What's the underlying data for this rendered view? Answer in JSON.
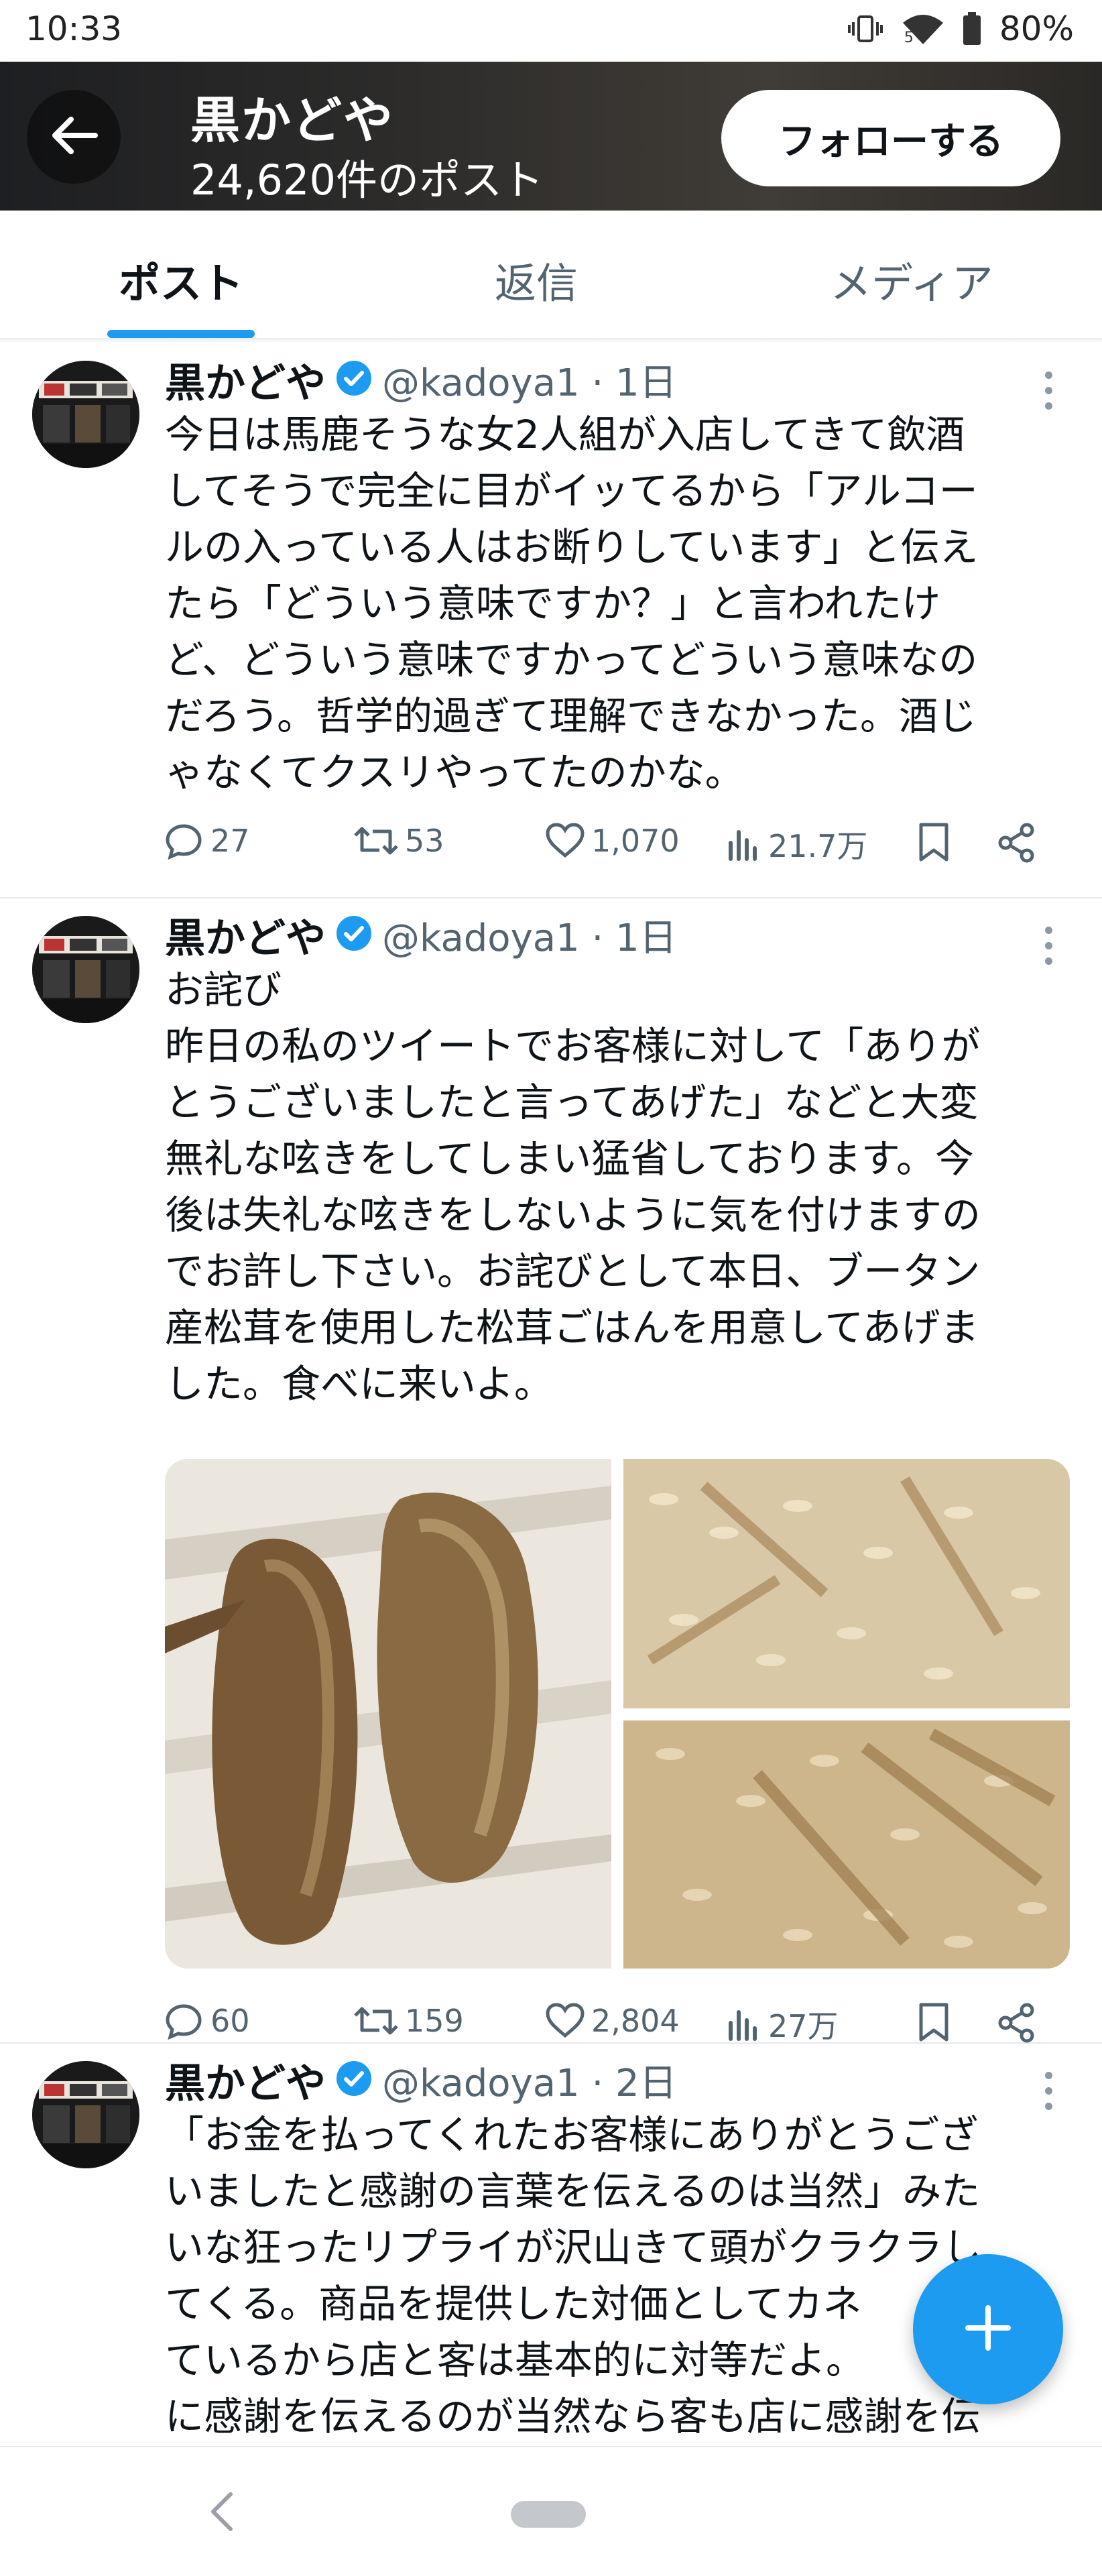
{
  "status_bar": {
    "time": "10:33",
    "battery": "80%",
    "network_badge": "5"
  },
  "header": {
    "title": "黒かどや",
    "subtitle": "24,620件のポスト",
    "follow_label": "フォローする",
    "back_icon": "arrow-left-icon"
  },
  "tabs": [
    {
      "label": "ポスト",
      "active": true
    },
    {
      "label": "返信",
      "active": false
    },
    {
      "label": "メディア",
      "active": false
    }
  ],
  "tweets": [
    {
      "name": "黒かどや",
      "handle_time": "@kadoya1 · 1日",
      "text": "今日は馬鹿そうな女2人組が入店してきて飲酒\nしてそうで完全に目がイッてるから「アルコー\nルの入っている人はお断りしています」と伝え\nたら「どういう意味ですか？」と言われたけ\nど、どういう意味ですかってどういう意味なの\nだろう。哲学的過ぎて理解できなかった。酒じ\nゃなくてクスリやってたのかな。",
      "replies": "27",
      "reposts": "53",
      "likes": "1,070",
      "views": "21.7万"
    },
    {
      "name": "黒かどや",
      "handle_time": "@kadoya1 · 1日",
      "text": "お詫び\n昨日の私のツイートでお客様に対して「ありが\nとうございましたと言ってあげた」などと大変\n無礼な呟きをしてしまい猛省しております。今\n後は失礼な呟きをしないように気を付けますの\nでお許し下さい。お詫びとして本日、ブータン\n産松茸を使用した松茸ごはんを用意してあげま\nした。食べに来いよ。",
      "replies": "60",
      "reposts": "159",
      "likes": "2,804",
      "views": "27万"
    },
    {
      "name": "黒かどや",
      "handle_time": "@kadoya1 · 2日",
      "text": "「お金を払ってくれたお客様にありがとうござ\nいましたと感謝の言葉を伝えるのは当然」みた\nいな狂ったリプライが沢山きて頭がクラクラし\nてくる。商品を提供した対価としてカネ\nているから店と客は基本的に対等だよ。\nに感謝を伝えるのが当然なら客も店に感謝を伝"
    }
  ],
  "colors": {
    "accent": "#1d9bf0",
    "text": "#0f1419",
    "muted": "#536471"
  }
}
